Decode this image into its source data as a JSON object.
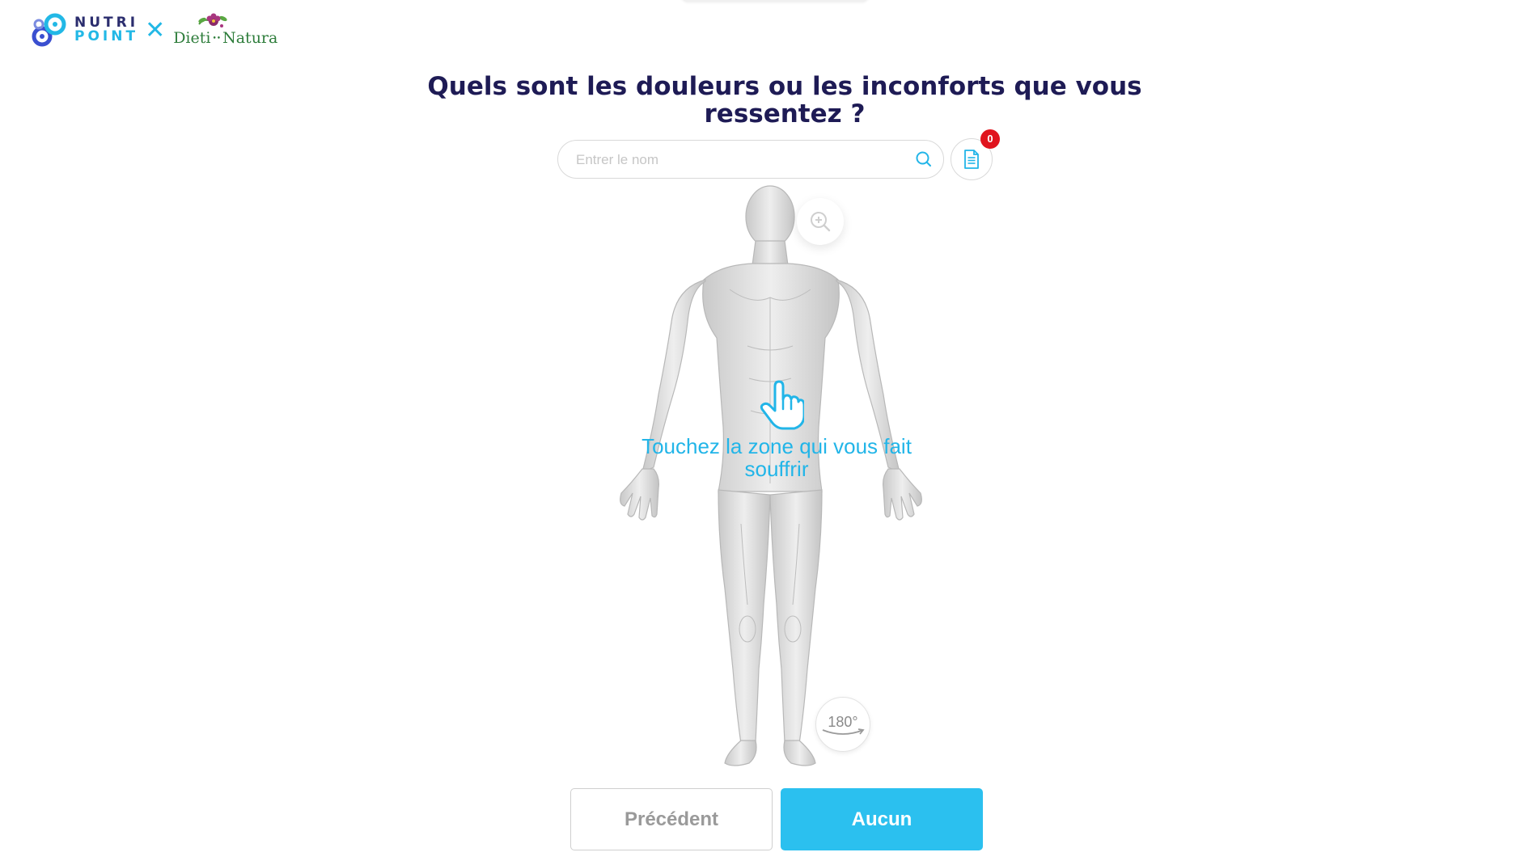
{
  "header": {
    "brand_1_line1": "NUTRI",
    "brand_1_line2": "POINT",
    "separator": "✕",
    "brand_2": "Dieti Natura",
    "brand_2_part1": "Dieti",
    "brand_2_part2": "Natura"
  },
  "question": {
    "title": "Quels sont les douleurs ou les inconforts que vous ressentez ?"
  },
  "search": {
    "placeholder": "Entrer le nom",
    "value": ""
  },
  "selection": {
    "count": "0"
  },
  "body_map": {
    "instruction": "Touchez la zone qui vous fait souffrir",
    "rotate_label": "180°"
  },
  "actions": {
    "previous_label": "Précédent",
    "none_label": "Aucun"
  },
  "colors": {
    "accent": "#2bc0ef",
    "title": "#1e1b55",
    "badge": "#e0141e"
  },
  "icons": [
    "search-icon",
    "document-icon",
    "zoom-in-icon",
    "hand-pointer-icon",
    "rotate-icon"
  ]
}
